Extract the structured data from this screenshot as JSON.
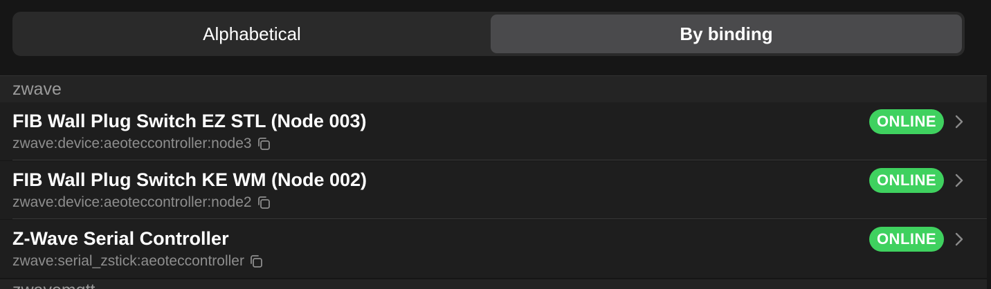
{
  "segmented": {
    "options": [
      "Alphabetical",
      "By binding"
    ],
    "selected": "By binding"
  },
  "sections": [
    {
      "title": "zwave",
      "items": [
        {
          "title": "FIB Wall Plug Switch EZ STL (Node 003)",
          "uid": "zwave:device:aeoteccontroller:node3",
          "status": "ONLINE",
          "icon": "copy-icon"
        },
        {
          "title": "FIB Wall Plug Switch KE WM (Node 002)",
          "uid": "zwave:device:aeoteccontroller:node2",
          "status": "ONLINE",
          "icon": "copy-icon"
        },
        {
          "title": "Z-Wave Serial Controller",
          "uid": "zwave:serial_zstick:aeoteccontroller",
          "status": "ONLINE",
          "icon": "copy-icon"
        }
      ]
    },
    {
      "title": "zwavemqtt"
    }
  ],
  "colors": {
    "status_online": "#3fd15f",
    "selected_segment": "#4a4a4c",
    "background": "#161616"
  }
}
